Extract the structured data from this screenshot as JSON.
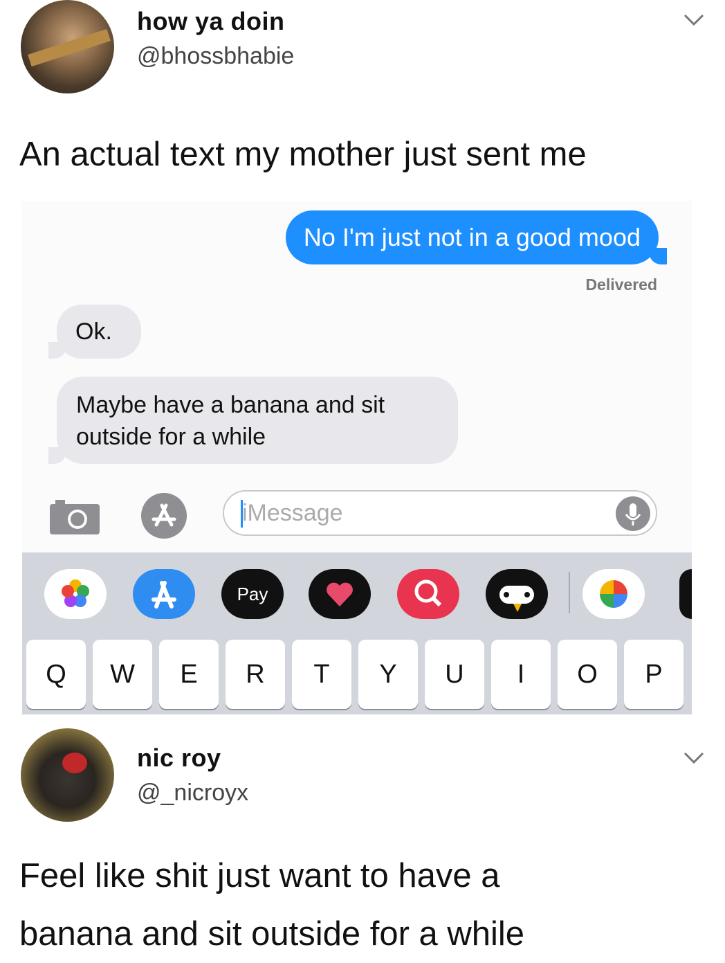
{
  "tweet1": {
    "display_name": "how ya doin",
    "handle": "@bhossbhabie",
    "text": "An actual text my mother just sent me"
  },
  "imessage": {
    "sent_message": "No I'm just not in a good mood",
    "delivered_label": "Delivered",
    "received_messages": [
      "Ok.",
      "Maybe have a banana and sit outside for a while"
    ],
    "input_placeholder": "iMessage",
    "apps": [
      {
        "icon": "photos-icon"
      },
      {
        "icon": "app-store-icon"
      },
      {
        "icon": "apple-pay-icon",
        "label": "Pay"
      },
      {
        "icon": "digital-touch-icon"
      },
      {
        "icon": "search-images-icon"
      },
      {
        "icon": "game-pigeon-icon"
      },
      {
        "icon": "google-photos-icon"
      },
      {
        "icon": "more-apps-icon"
      }
    ],
    "keyboard_row": [
      "Q",
      "W",
      "E",
      "R",
      "T",
      "Y",
      "U",
      "I",
      "O",
      "P"
    ]
  },
  "tweet2": {
    "display_name": "nic roy",
    "handle": "@_nicroyx",
    "text_lines": [
      "Feel like shit just want to have a",
      "banana and sit outside for a while"
    ]
  },
  "colors": {
    "imessage_blue": "#1e8fff",
    "received_bubble": "#e8e8ec",
    "keyboard_bg": "#d2d5dc"
  }
}
